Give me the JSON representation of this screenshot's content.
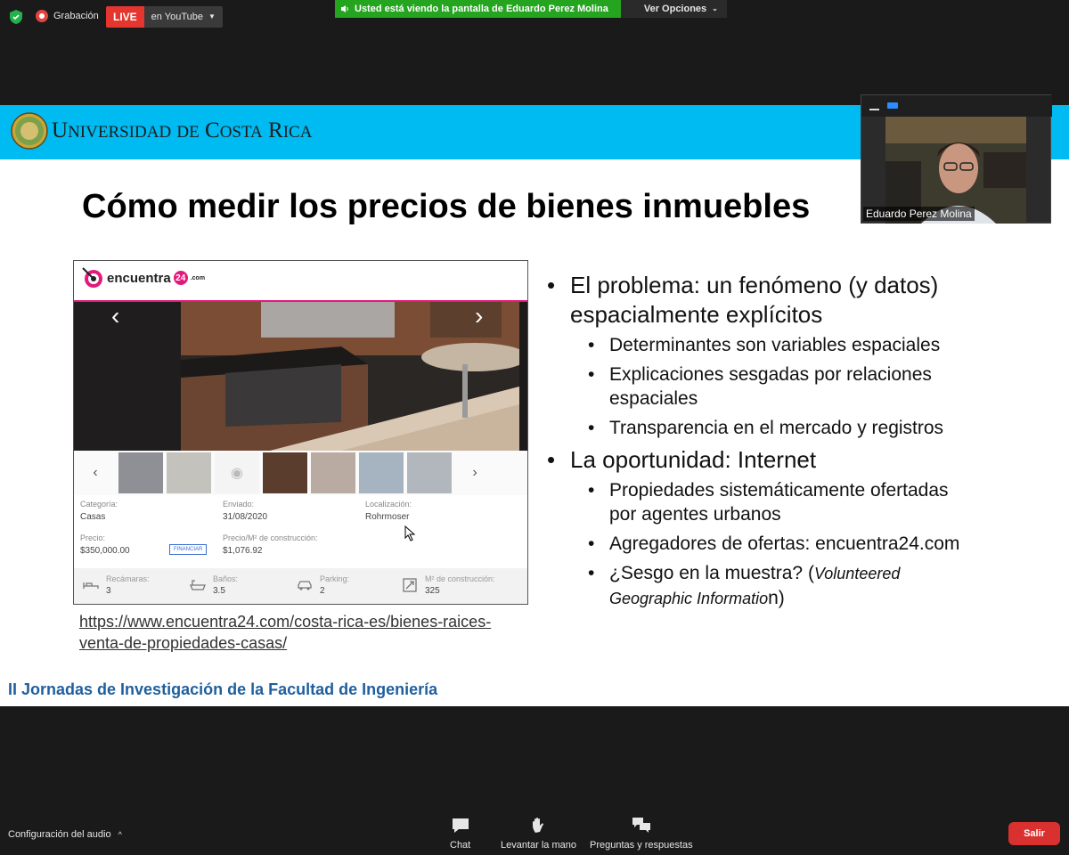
{
  "top_bar": {
    "recording_label": "Grabación",
    "live_badge": "LIVE",
    "live_platform": "en YouTube",
    "viewing_banner": "Usted está viendo la pantalla de Eduardo Perez Molina",
    "view_options": "Ver Opciones"
  },
  "slide": {
    "university_name": {
      "u": "U",
      "niversidad": "NIVERSIDAD",
      "de": "DE",
      "c": "C",
      "osta": "OSTA",
      "r": "R",
      "ica": "ICA"
    },
    "title": "Cómo medir los precios de bienes inmuebles",
    "listing": {
      "logo_text": "encuentra",
      "logo_number": "24",
      "logo_suffix": ".com",
      "fields": {
        "categoria_label": "Categoría:",
        "categoria_value": "Casas",
        "enviado_label": "Enviado:",
        "enviado_value": "31/08/2020",
        "localizacion_label": "Localización:",
        "localizacion_value": "Rohrmoser",
        "precio_label": "Precio:",
        "precio_value": "$350,000.00",
        "financiar_label": "FINANCIAR",
        "precio_m2_label": "Precio/M² de construcción:",
        "precio_m2_value": "$1,076.92"
      },
      "stats": {
        "recamaras_label": "Recámaras:",
        "recamaras_value": "3",
        "banos_label": "Baños:",
        "banos_value": "3.5",
        "parking_label": "Parking:",
        "parking_value": "2",
        "m2_label": "M² de construcción:",
        "m2_value": "325"
      }
    },
    "url_line1": "https://www.encuentra24.com/costa-rica-es/bienes-raices-",
    "url_line2": "venta-de-propiedades-casas/",
    "bullets": {
      "b1": "El problema: un fenómeno (y datos) espacialmente explícitos",
      "b1_1": "Determinantes son variables espaciales",
      "b1_2": "Explicaciones sesgadas por relaciones espaciales",
      "b1_3": "Transparencia en el mercado y registros",
      "b2": "La oportunidad: Internet",
      "b2_1": "Propiedades sistemáticamente ofertadas por agentes urbanos",
      "b2_2": "Agregadores de ofertas: encuentra24.com",
      "b2_3_main": "¿Sesgo en la muestra? (",
      "b2_3_italic_a": "Volunteered Geographic Informatio",
      "b2_3_tail": "n)"
    },
    "footer": "II Jornadas de Investigación de la Facultad de Ingeniería"
  },
  "webcam": {
    "participant_name": "Eduardo Perez Molina"
  },
  "bottom_bar": {
    "audio_settings": "Configuración del audio",
    "chat": "Chat",
    "raise_hand": "Levantar la mano",
    "qa": "Preguntas y respuestas",
    "exit": "Salir"
  },
  "colors": {
    "slide_header": "#00baf2",
    "live_red": "#e4362e",
    "banner_green": "#24a41f",
    "exit_red": "#d9312f",
    "brand_pink": "#e4197c"
  }
}
